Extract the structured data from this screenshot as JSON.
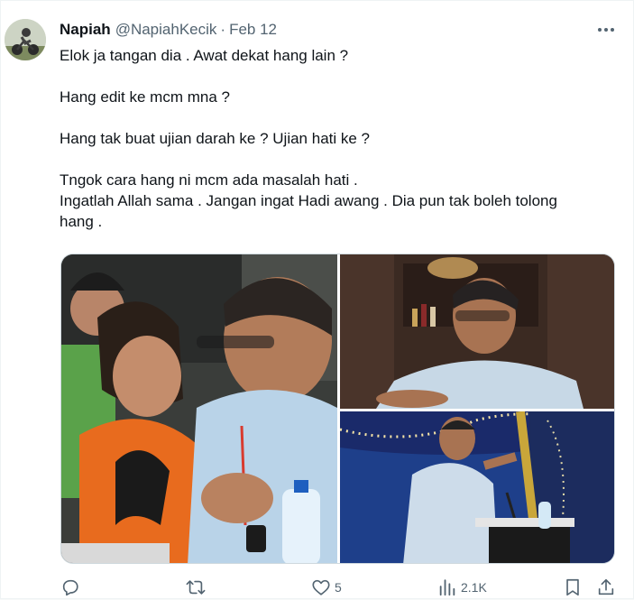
{
  "tweet": {
    "display_name": "Napiah",
    "handle": "@NapiahKecik",
    "separator": "·",
    "date": "Feb 12",
    "lines": [
      "Elok ja tangan dia . Awat dekat hang lain ?",
      "",
      "Hang edit ke mcm mna ?",
      "",
      "Hang tak buat ujian darah ke ? Ujian hati ke ?",
      "",
      "Tngok cara hang ni mcm ada masalah hati .",
      "Ingatlah Allah sama . Jangan ingat Hadi awang . Dia pun tak boleh tolong",
      "hang ."
    ]
  },
  "media": {
    "photos": [
      {
        "name": "photo-man-with-child",
        "icon": "photo"
      },
      {
        "name": "photo-man-at-desk",
        "icon": "photo"
      },
      {
        "name": "photo-man-speaking-podium",
        "icon": "photo"
      }
    ]
  },
  "actions": {
    "reply": {
      "icon": "reply-icon",
      "count": ""
    },
    "retweet": {
      "icon": "retweet-icon",
      "count": ""
    },
    "like": {
      "icon": "heart-icon",
      "count": "5"
    },
    "views": {
      "icon": "views-icon",
      "count": "2.1K"
    },
    "bookmark": {
      "icon": "bookmark-icon"
    },
    "share": {
      "icon": "share-icon"
    }
  },
  "colors": {
    "text": "#0f1419",
    "secondary": "#536471",
    "border": "#cfd9de"
  }
}
